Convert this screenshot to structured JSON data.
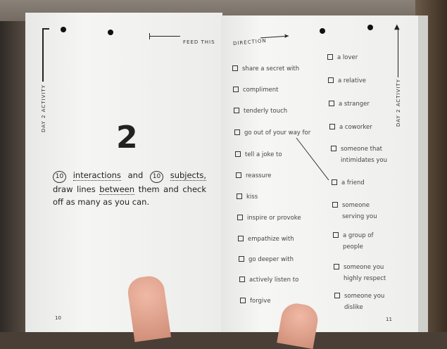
{
  "left_page": {
    "header_label": "FEED THIS",
    "side_label": "DAY 2 ACTIVITY",
    "big_number": "2",
    "instructions": {
      "count1": "10",
      "word1": "interactions",
      "and": "and",
      "count2": "10",
      "word2": "subjects,",
      "line2_start": "draw lines",
      "between": "between",
      "line2_end": "them and",
      "line3": "check off as many as you can."
    },
    "page_number": "10"
  },
  "right_page": {
    "header_label": "DIRECTION",
    "side_label": "DAY 2 ACTIVITY",
    "interactions": [
      "share a secret with",
      "compliment",
      "tenderly touch",
      "go out of your way for",
      "tell a joke to",
      "reassure",
      "kiss",
      "inspire or provoke",
      "empathize with",
      "go deeper with",
      "actively listen to",
      "forgive"
    ],
    "subjects": [
      [
        "a lover"
      ],
      [
        "a relative"
      ],
      [
        "a stranger"
      ],
      [
        "a coworker"
      ],
      [
        "someone that",
        "intimidates you"
      ],
      [
        "a friend"
      ],
      [
        "someone",
        "serving you"
      ],
      [
        "a group of",
        "people"
      ],
      [
        "someone you",
        "highly respect"
      ],
      [
        "someone you",
        "dislike"
      ]
    ],
    "connection": {
      "from": "go out of your way for",
      "to": "a friend"
    },
    "page_number": "11"
  }
}
